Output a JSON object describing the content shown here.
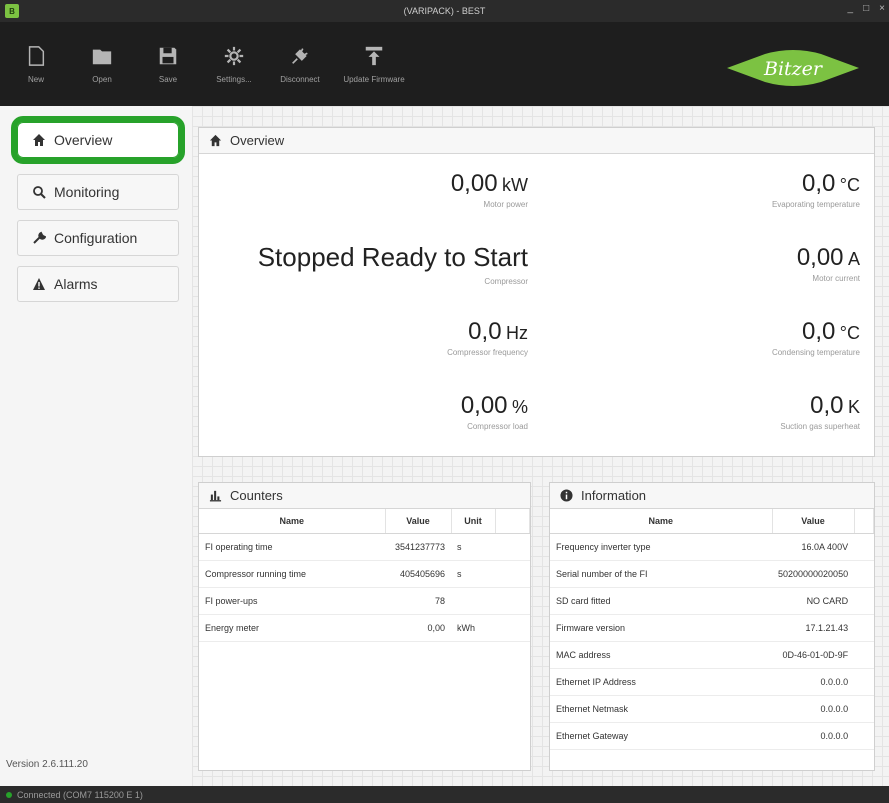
{
  "window": {
    "title": "(VARIPACK) - BEST"
  },
  "toolbar": {
    "items": [
      {
        "label": "New",
        "icon": "new-file-icon"
      },
      {
        "label": "Open",
        "icon": "folder-open-icon"
      },
      {
        "label": "Save",
        "icon": "save-icon"
      },
      {
        "label": "Settings...",
        "icon": "gear-icon"
      },
      {
        "label": "Disconnect",
        "icon": "plug-icon"
      },
      {
        "label": "Update Firmware",
        "icon": "upload-icon"
      }
    ],
    "logo_text": "Bitzer"
  },
  "sidebar": {
    "items": [
      {
        "label": "Overview",
        "icon": "home-icon"
      },
      {
        "label": "Monitoring",
        "icon": "search-icon"
      },
      {
        "label": "Configuration",
        "icon": "wrench-icon"
      },
      {
        "label": "Alarms",
        "icon": "warning-icon"
      }
    ],
    "version": "Version 2.6.111.20"
  },
  "overview": {
    "title": "Overview",
    "motor_power": {
      "value": "0,00",
      "unit": "kW",
      "caption": "Motor power"
    },
    "evap_temp": {
      "value": "0,0",
      "unit": "°C",
      "caption": "Evaporating temperature"
    },
    "compressor_state": {
      "value": "Stopped Ready to Start",
      "caption": "Compressor"
    },
    "motor_current": {
      "value": "0,00",
      "unit": "A",
      "caption": "Motor current"
    },
    "comp_freq": {
      "value": "0,0",
      "unit": "Hz",
      "caption": "Compressor frequency"
    },
    "cond_temp": {
      "value": "0,0",
      "unit": "°C",
      "caption": "Condensing temperature"
    },
    "comp_load": {
      "value": "0,00",
      "unit": "%",
      "caption": "Compressor load"
    },
    "superheat": {
      "value": "0,0",
      "unit": "K",
      "caption": "Suction gas superheat"
    }
  },
  "counters": {
    "title": "Counters",
    "columns": [
      "Name",
      "Value",
      "Unit"
    ],
    "rows": [
      [
        "FI operating time",
        "3541237773",
        "s"
      ],
      [
        "Compressor running time",
        "405405696",
        "s"
      ],
      [
        "FI power-ups",
        "78",
        ""
      ],
      [
        "Energy meter",
        "0,00",
        "kWh"
      ]
    ]
  },
  "information": {
    "title": "Information",
    "columns": [
      "Name",
      "Value"
    ],
    "rows": [
      [
        "Frequency inverter type",
        "16.0A 400V"
      ],
      [
        "Serial number of the FI",
        "50200000020050"
      ],
      [
        "SD card fitted",
        "NO CARD"
      ],
      [
        "Firmware version",
        "17.1.21.43"
      ],
      [
        "MAC address",
        "0D-46-01-0D-9F"
      ],
      [
        "Ethernet IP Address",
        "0.0.0.0"
      ],
      [
        "Ethernet Netmask",
        "0.0.0.0"
      ],
      [
        "Ethernet Gateway",
        "0.0.0.0"
      ]
    ]
  },
  "statusbar": {
    "text": "Connected (COM7 115200 E 1)"
  },
  "colors": {
    "accent": "#27a22a",
    "logo_green": "#7cc242",
    "toolbar_bg": "#1e1e1e"
  }
}
